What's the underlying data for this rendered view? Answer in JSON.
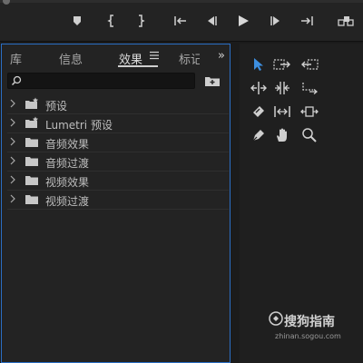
{
  "transport": {
    "buttons": [
      "marker-icon",
      "in-point-icon",
      "out-point-icon",
      "go-to-in-icon",
      "step-back-icon",
      "play-icon",
      "step-forward-icon",
      "go-to-out-icon",
      "insert-icon"
    ]
  },
  "panel": {
    "tabs": [
      {
        "label": "库"
      },
      {
        "label": "信息"
      },
      {
        "label": "效果"
      },
      {
        "label": "标记"
      }
    ],
    "more_glyph": "»",
    "search": {
      "value": "",
      "placeholder": ""
    },
    "items": [
      {
        "label": "预设",
        "icon": "preset-folder-icon"
      },
      {
        "label": "Lumetri 预设",
        "icon": "preset-folder-icon"
      },
      {
        "label": "音频效果",
        "icon": "folder-icon"
      },
      {
        "label": "音频过渡",
        "icon": "folder-icon"
      },
      {
        "label": "视频效果",
        "icon": "folder-icon"
      },
      {
        "label": "视频过渡",
        "icon": "folder-icon"
      }
    ]
  },
  "tools": [
    "selection-tool-icon",
    "track-select-tool-icon",
    "ripple-edit-tool-icon",
    "rolling-edit-tool-icon",
    "rate-stretch-tool-icon",
    "razor-tool-icon",
    "slip-tool-icon",
    "slide-tool-icon",
    "pen-tool-icon",
    "hand-tool-icon",
    "zoom-tool-icon"
  ],
  "colors": {
    "accent": "#2b6fc6",
    "selection_tool": "#3d8fe0"
  },
  "watermark": {
    "title": "搜狗指南",
    "url": "zhinan.sogou.com"
  }
}
